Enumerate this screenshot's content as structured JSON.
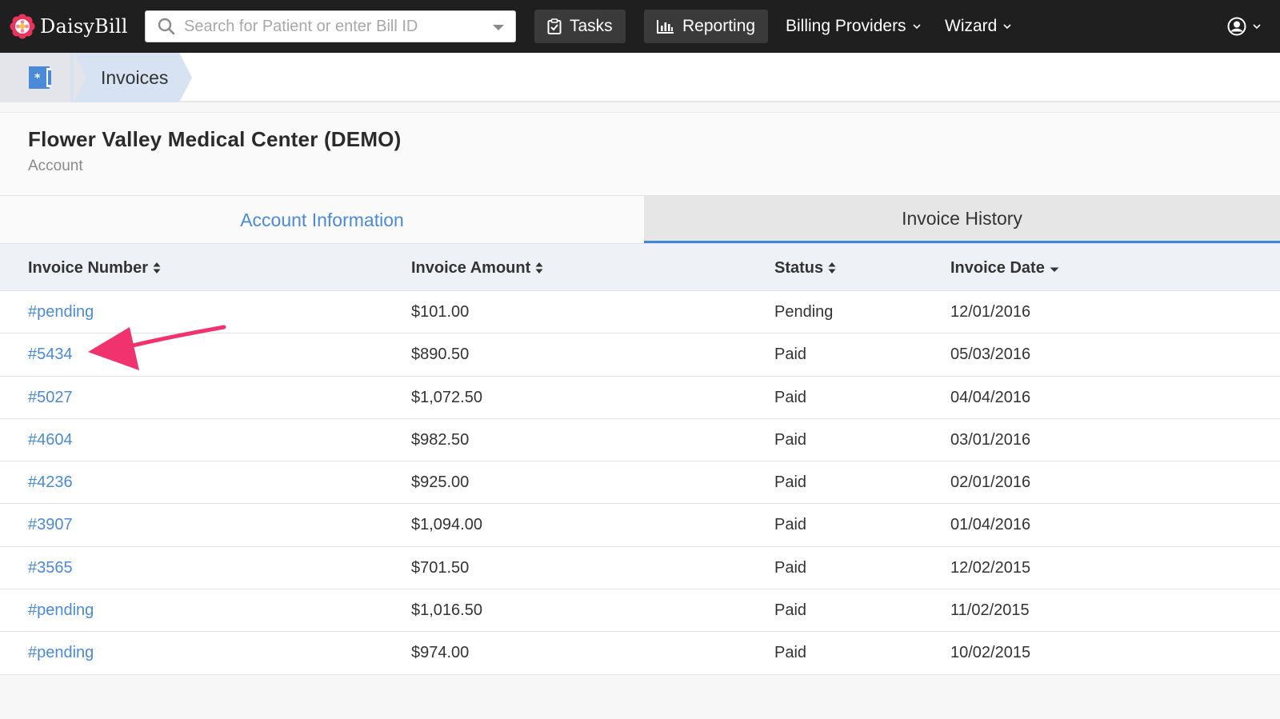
{
  "app": {
    "name": "DaisyBill"
  },
  "search": {
    "placeholder": "Search for Patient or enter Bill ID"
  },
  "nav": {
    "tasks_label": "Tasks",
    "reporting_label": "Reporting",
    "billing_providers_label": "Billing Providers",
    "wizard_label": "Wizard"
  },
  "breadcrumb": {
    "current": "Invoices"
  },
  "account": {
    "name": "Flower Valley Medical Center (DEMO)",
    "subtitle": "Account"
  },
  "tabs": [
    {
      "label": "Account Information",
      "active": false
    },
    {
      "label": "Invoice History",
      "active": true
    }
  ],
  "table": {
    "columns": [
      "Invoice Number",
      "Invoice Amount",
      "Status",
      "Invoice Date"
    ],
    "rows": [
      {
        "number": "#pending",
        "amount": "$101.00",
        "status": "Pending",
        "date": "12/01/2016"
      },
      {
        "number": "#5434",
        "amount": "$890.50",
        "status": "Paid",
        "date": "05/03/2016"
      },
      {
        "number": "#5027",
        "amount": "$1,072.50",
        "status": "Paid",
        "date": "04/04/2016"
      },
      {
        "number": "#4604",
        "amount": "$982.50",
        "status": "Paid",
        "date": "03/01/2016"
      },
      {
        "number": "#4236",
        "amount": "$925.00",
        "status": "Paid",
        "date": "02/01/2016"
      },
      {
        "number": "#3907",
        "amount": "$1,094.00",
        "status": "Paid",
        "date": "01/04/2016"
      },
      {
        "number": "#3565",
        "amount": "$701.50",
        "status": "Paid",
        "date": "12/02/2015"
      },
      {
        "number": "#pending",
        "amount": "$1,016.50",
        "status": "Paid",
        "date": "11/02/2015"
      },
      {
        "number": "#pending",
        "amount": "$974.00",
        "status": "Paid",
        "date": "10/02/2015"
      }
    ]
  },
  "colors": {
    "link": "#4a8ad8",
    "nav_bg": "#1f1f1f",
    "active_tab_underline": "#3f86d6",
    "annotation_arrow": "#f0336e"
  },
  "icons": {
    "logo": "daisy-flower-icon",
    "search": "search-icon",
    "tasks": "clipboard-check-icon",
    "reporting": "bar-chart-icon",
    "user": "user-circle-icon",
    "breadcrumb_home": "patient-card-icon"
  }
}
